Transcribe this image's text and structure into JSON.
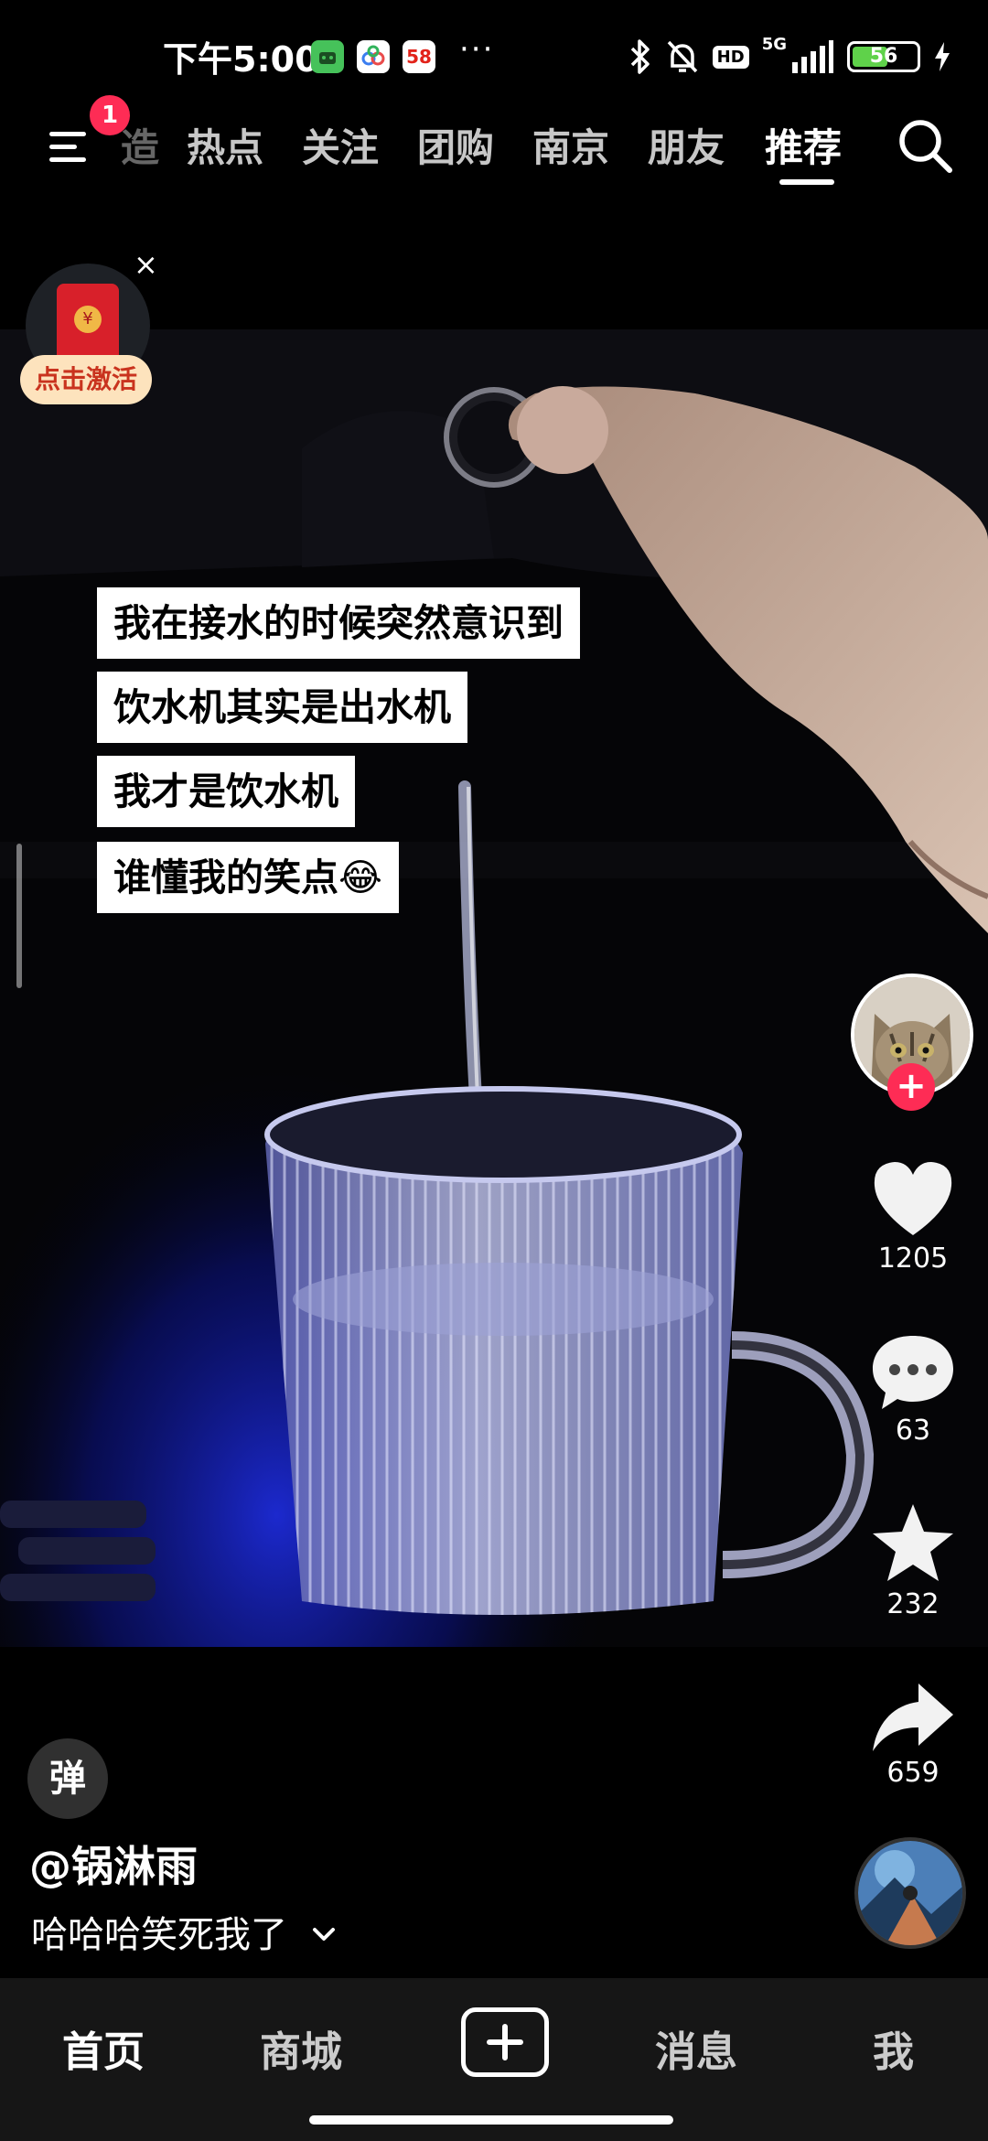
{
  "status_bar": {
    "time": "下午5:00",
    "overflow": "···",
    "hd": "HD",
    "network": "5G",
    "battery_level": "56",
    "battery_fraction": 0.56,
    "app_badge_58": "58"
  },
  "top_nav": {
    "menu_badge": "1",
    "partial_tab": "造",
    "tabs": [
      "热点",
      "关注",
      "团购",
      "南京",
      "朋友",
      "推荐"
    ],
    "active_tab": "推荐"
  },
  "red_packet": {
    "label": "点击激活",
    "close": "×",
    "coin": "¥"
  },
  "captions": [
    "我在接水的时候突然意识到",
    "饮水机其实是出水机",
    "我才是饮水机",
    "谁懂我的笑点😂"
  ],
  "rail": {
    "follow": "+",
    "likes": "1205",
    "comments": "63",
    "favorites": "232",
    "shares": "659"
  },
  "post": {
    "danmaku": "弹",
    "author": "@锅淋雨",
    "description": "哈哈哈笑死我了"
  },
  "tab_bar": {
    "home": "首页",
    "mall": "商城",
    "messages": "消息",
    "me": "我"
  },
  "colors": {
    "accent": "#fe2c55",
    "battery": "#5fd24a",
    "red_packet_bg": "#fde3bd",
    "red_packet_text": "#c9331e"
  }
}
